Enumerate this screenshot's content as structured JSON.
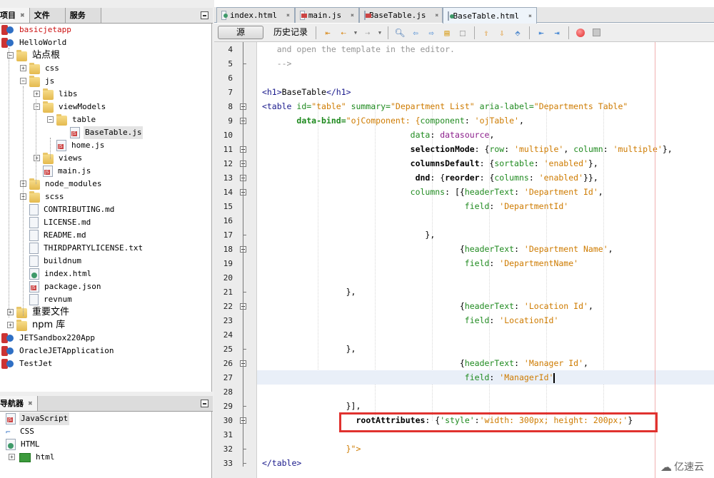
{
  "projects_panel": {
    "tabs": [
      {
        "label": "项目",
        "active": true
      },
      {
        "label": "文件",
        "active": false
      },
      {
        "label": "服务",
        "active": false
      }
    ],
    "tree": [
      {
        "label": "basicjetapp",
        "icon": "project-warning-icon",
        "level": 0,
        "error": true
      },
      {
        "label": "HelloWorld",
        "icon": "project-icon",
        "level": 0
      },
      {
        "label": "站点根",
        "icon": "site-root-folder-icon",
        "level": 1
      },
      {
        "label": "css",
        "icon": "folder-error-icon",
        "level": 2
      },
      {
        "label": "js",
        "icon": "folder-icon",
        "level": 2
      },
      {
        "label": "libs",
        "icon": "folder-icon",
        "level": 3
      },
      {
        "label": "viewModels",
        "icon": "folder-icon",
        "level": 3
      },
      {
        "label": "table",
        "icon": "folder-icon",
        "level": 4
      },
      {
        "label": "BaseTable.js",
        "icon": "js-file-icon",
        "level": 5,
        "selected": true
      },
      {
        "label": "home.js",
        "icon": "js-file-icon",
        "level": 4
      },
      {
        "label": "views",
        "icon": "folder-icon",
        "level": 3
      },
      {
        "label": "main.js",
        "icon": "js-file-icon",
        "level": 3
      },
      {
        "label": "node_modules",
        "icon": "folder-error-icon",
        "level": 2
      },
      {
        "label": "scss",
        "icon": "folder-icon",
        "level": 2
      },
      {
        "label": "CONTRIBUTING.md",
        "icon": "file-icon",
        "level": 2
      },
      {
        "label": "LICENSE.md",
        "icon": "file-icon",
        "level": 2
      },
      {
        "label": "README.md",
        "icon": "file-icon",
        "level": 2
      },
      {
        "label": "THIRDPARTYLICENSE.txt",
        "icon": "file-icon",
        "level": 2
      },
      {
        "label": "buildnum",
        "icon": "file-icon",
        "level": 2
      },
      {
        "label": "index.html",
        "icon": "html-file-icon",
        "level": 2
      },
      {
        "label": "package.json",
        "icon": "js-file-icon",
        "level": 2
      },
      {
        "label": "revnum",
        "icon": "file-icon",
        "level": 2
      },
      {
        "label": "重要文件",
        "icon": "important-files-folder-icon",
        "level": 1
      },
      {
        "label": "npm 库",
        "icon": "npm-library-folder-icon",
        "level": 1
      },
      {
        "label": "JETSandbox220App",
        "icon": "project-icon",
        "level": 0
      },
      {
        "label": "OracleJETApplication",
        "icon": "project-icon",
        "level": 0
      },
      {
        "label": "TestJet",
        "icon": "project-icon",
        "level": 0
      }
    ]
  },
  "navigator_panel": {
    "tab_label": "导航器",
    "tree": [
      {
        "label": "JavaScript",
        "icon": "js-file-icon",
        "selected": true
      },
      {
        "label": "CSS",
        "icon": "css-icon"
      },
      {
        "label": "HTML",
        "icon": "html-file-icon"
      },
      {
        "label": "html",
        "icon": "html-element-icon",
        "child": true
      }
    ]
  },
  "editor": {
    "tabs": [
      {
        "label": "index.html",
        "icon": "html",
        "active": false
      },
      {
        "label": "main.js",
        "icon": "js",
        "active": false
      },
      {
        "label": "BaseTable.js",
        "icon": "js",
        "active": false
      },
      {
        "label": "BaseTable.html",
        "icon": "html",
        "active": true
      }
    ],
    "toolbar": {
      "source_label": "源",
      "history_label": "历史记录"
    },
    "lines": [
      {
        "n": 4,
        "tokens": [
          {
            "t": "and open the template in the editor.",
            "c": "comment"
          }
        ],
        "indent": "   "
      },
      {
        "n": 5,
        "tokens": [
          {
            "t": "-->",
            "c": "comment"
          }
        ],
        "indent": "   "
      },
      {
        "n": 6,
        "tokens": [],
        "indent": ""
      },
      {
        "n": 7,
        "tokens": [
          {
            "t": "<h1>",
            "c": "tag"
          },
          {
            "t": "BaseTable",
            "c": "plain"
          },
          {
            "t": "</h1>",
            "c": "tag"
          }
        ],
        "indent": ""
      },
      {
        "n": 8,
        "tokens": [
          {
            "t": "<table ",
            "c": "tag"
          },
          {
            "t": "id=",
            "c": "attr"
          },
          {
            "t": "\"table\"",
            "c": "str"
          },
          {
            "t": " summary=",
            "c": "attr"
          },
          {
            "t": "\"Department List\"",
            "c": "str"
          },
          {
            "t": " aria-label=",
            "c": "attr"
          },
          {
            "t": "\"Departments Table\"",
            "c": "str"
          }
        ],
        "indent": ""
      },
      {
        "n": 9,
        "tokens": [
          {
            "t": "data-bind=",
            "c": "attrbold"
          },
          {
            "t": "\"ojComponent: {",
            "c": "str2"
          },
          {
            "t": "component",
            "c": "prop"
          },
          {
            "t": ": ",
            "c": "plain"
          },
          {
            "t": "'ojTable'",
            "c": "str"
          },
          {
            "t": ",",
            "c": "plain"
          }
        ],
        "indent": "       "
      },
      {
        "n": 10,
        "tokens": [
          {
            "t": "data",
            "c": "prop"
          },
          {
            "t": ": ",
            "c": "plain"
          },
          {
            "t": "datasource",
            "c": "pur"
          },
          {
            "t": ",",
            "c": "plain"
          }
        ],
        "indent": "                              "
      },
      {
        "n": 11,
        "tokens": [
          {
            "t": "selectionMode",
            "c": "key"
          },
          {
            "t": ": {",
            "c": "plain"
          },
          {
            "t": "row",
            "c": "prop"
          },
          {
            "t": ": ",
            "c": "plain"
          },
          {
            "t": "'multiple'",
            "c": "str"
          },
          {
            "t": ", ",
            "c": "plain"
          },
          {
            "t": "column",
            "c": "prop"
          },
          {
            "t": ": ",
            "c": "plain"
          },
          {
            "t": "'multiple'",
            "c": "str"
          },
          {
            "t": "},",
            "c": "plain"
          }
        ],
        "indent": "                              "
      },
      {
        "n": 12,
        "tokens": [
          {
            "t": "columnsDefault",
            "c": "key"
          },
          {
            "t": ": {",
            "c": "plain"
          },
          {
            "t": "sortable",
            "c": "prop"
          },
          {
            "t": ": ",
            "c": "plain"
          },
          {
            "t": "'enabled'",
            "c": "str"
          },
          {
            "t": "},",
            "c": "plain"
          }
        ],
        "indent": "                              "
      },
      {
        "n": 13,
        "tokens": [
          {
            "t": "dnd",
            "c": "key"
          },
          {
            "t": ": {",
            "c": "plain"
          },
          {
            "t": "reorder",
            "c": "key"
          },
          {
            "t": ": {",
            "c": "plain"
          },
          {
            "t": "columns",
            "c": "prop"
          },
          {
            "t": ": ",
            "c": "plain"
          },
          {
            "t": "'enabled'",
            "c": "str"
          },
          {
            "t": "}},",
            "c": "plain"
          }
        ],
        "indent": "                               "
      },
      {
        "n": 14,
        "tokens": [
          {
            "t": "columns",
            "c": "prop"
          },
          {
            "t": ": [{",
            "c": "plain"
          },
          {
            "t": "headerText",
            "c": "prop"
          },
          {
            "t": ": ",
            "c": "plain"
          },
          {
            "t": "'Department Id'",
            "c": "str"
          },
          {
            "t": ",",
            "c": "plain"
          }
        ],
        "indent": "                              "
      },
      {
        "n": 15,
        "tokens": [
          {
            "t": "field",
            "c": "prop"
          },
          {
            "t": ": ",
            "c": "plain"
          },
          {
            "t": "'DepartmentId'",
            "c": "str"
          }
        ],
        "indent": "                                         "
      },
      {
        "n": 16,
        "tokens": [],
        "indent": ""
      },
      {
        "n": 17,
        "tokens": [
          {
            "t": "},",
            "c": "plain"
          }
        ],
        "indent": "                                 "
      },
      {
        "n": 18,
        "tokens": [
          {
            "t": "{",
            "c": "plain"
          },
          {
            "t": "headerText",
            "c": "prop"
          },
          {
            "t": ": ",
            "c": "plain"
          },
          {
            "t": "'Department Name'",
            "c": "str"
          },
          {
            "t": ",",
            "c": "plain"
          }
        ],
        "indent": "                                        "
      },
      {
        "n": 19,
        "tokens": [
          {
            "t": "field",
            "c": "prop"
          },
          {
            "t": ": ",
            "c": "plain"
          },
          {
            "t": "'DepartmentName'",
            "c": "str"
          }
        ],
        "indent": "                                         "
      },
      {
        "n": 20,
        "tokens": [],
        "indent": ""
      },
      {
        "n": 21,
        "tokens": [
          {
            "t": "},",
            "c": "plain"
          }
        ],
        "indent": "                 "
      },
      {
        "n": 22,
        "tokens": [
          {
            "t": "{",
            "c": "plain"
          },
          {
            "t": "headerText",
            "c": "prop"
          },
          {
            "t": ": ",
            "c": "plain"
          },
          {
            "t": "'Location Id'",
            "c": "str"
          },
          {
            "t": ",",
            "c": "plain"
          }
        ],
        "indent": "                                        "
      },
      {
        "n": 23,
        "tokens": [
          {
            "t": "field",
            "c": "prop"
          },
          {
            "t": ": ",
            "c": "plain"
          },
          {
            "t": "'LocationId'",
            "c": "str"
          }
        ],
        "indent": "                                         "
      },
      {
        "n": 24,
        "tokens": [],
        "indent": ""
      },
      {
        "n": 25,
        "tokens": [
          {
            "t": "},",
            "c": "plain"
          }
        ],
        "indent": "                 "
      },
      {
        "n": 26,
        "tokens": [
          {
            "t": "{",
            "c": "plain"
          },
          {
            "t": "headerText",
            "c": "prop"
          },
          {
            "t": ": ",
            "c": "plain"
          },
          {
            "t": "'Manager Id'",
            "c": "str"
          },
          {
            "t": ",",
            "c": "plain"
          }
        ],
        "indent": "                                        "
      },
      {
        "n": 27,
        "tokens": [
          {
            "t": "field",
            "c": "prop"
          },
          {
            "t": ": ",
            "c": "plain"
          },
          {
            "t": "'ManagerId'",
            "c": "str"
          }
        ],
        "indent": "                                         ",
        "current": true
      },
      {
        "n": 28,
        "tokens": [],
        "indent": ""
      },
      {
        "n": 29,
        "tokens": [
          {
            "t": "}],",
            "c": "plain"
          }
        ],
        "indent": "                 "
      },
      {
        "n": 30,
        "tokens": [
          {
            "t": "rootAttributes",
            "c": "key"
          },
          {
            "t": ": {",
            "c": "plain"
          },
          {
            "t": "'style'",
            "c": "prop"
          },
          {
            "t": ":",
            "c": "plain"
          },
          {
            "t": "'width: 300px; height: 200px;'",
            "c": "str"
          },
          {
            "t": "}",
            "c": "plain"
          }
        ],
        "indent": "                   "
      },
      {
        "n": 31,
        "tokens": [],
        "indent": ""
      },
      {
        "n": 32,
        "tokens": [
          {
            "t": "}\">",
            "c": "str2"
          }
        ],
        "indent": "                 "
      },
      {
        "n": 33,
        "tokens": [
          {
            "t": "</table>",
            "c": "tag"
          }
        ],
        "indent": ""
      }
    ]
  },
  "watermark": {
    "text": "亿速云"
  }
}
